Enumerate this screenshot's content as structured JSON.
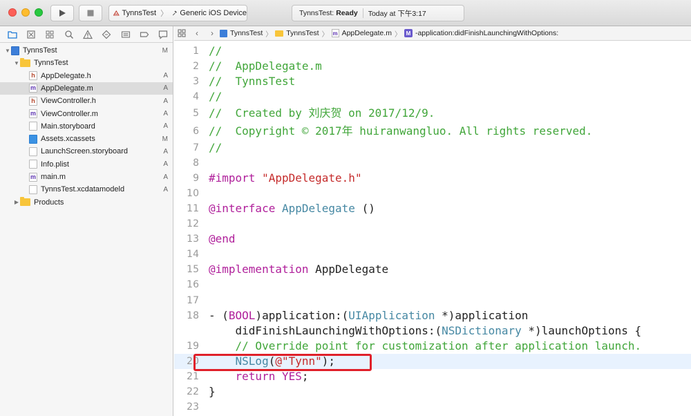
{
  "toolbar": {
    "scheme_project": "TynnsTest",
    "scheme_device": "Generic iOS Device",
    "status_project": "TynnsTest:",
    "status_state": "Ready",
    "status_time": "Today at 下午3:17"
  },
  "navigator": {
    "tabs": [
      "folder-icon",
      "source-control-icon",
      "symbol-icon",
      "search-icon",
      "warning-icon",
      "test-icon",
      "debug-icon",
      "breakpoint-icon",
      "report-icon"
    ],
    "project_status": "M",
    "items": [
      {
        "label": "TynnsTest",
        "kind": "project",
        "indent": 0,
        "disclosure": "▼",
        "status": "M"
      },
      {
        "label": "TynnsTest",
        "kind": "folder",
        "indent": 1,
        "disclosure": "▼",
        "status": ""
      },
      {
        "label": "AppDelegate.h",
        "kind": "h",
        "indent": 2,
        "status": "A"
      },
      {
        "label": "AppDelegate.m",
        "kind": "m",
        "indent": 2,
        "status": "A",
        "selected": true
      },
      {
        "label": "ViewController.h",
        "kind": "h",
        "indent": 2,
        "status": "A"
      },
      {
        "label": "ViewController.m",
        "kind": "m",
        "indent": 2,
        "status": "A"
      },
      {
        "label": "Main.storyboard",
        "kind": "sb",
        "indent": 2,
        "status": "A"
      },
      {
        "label": "Assets.xcassets",
        "kind": "assets",
        "indent": 2,
        "status": "M"
      },
      {
        "label": "LaunchScreen.storyboard",
        "kind": "sb",
        "indent": 2,
        "status": "A"
      },
      {
        "label": "Info.plist",
        "kind": "pl",
        "indent": 2,
        "status": "A"
      },
      {
        "label": "main.m",
        "kind": "m",
        "indent": 2,
        "status": "A"
      },
      {
        "label": "TynnsTest.xcdatamodeld",
        "kind": "dm",
        "indent": 2,
        "status": "A"
      },
      {
        "label": "Products",
        "kind": "folder",
        "indent": 1,
        "disclosure": "▶",
        "status": ""
      }
    ]
  },
  "jumpbar": {
    "crumbs": [
      "TynnsTest",
      "TynnsTest",
      "AppDelegate.m",
      "-application:didFinishLaunchingWithOptions:"
    ]
  },
  "editor": {
    "current_line": "20",
    "lines": [
      {
        "n": "1",
        "tokens": [
          [
            "c-comment",
            "//"
          ]
        ]
      },
      {
        "n": "2",
        "tokens": [
          [
            "c-comment",
            "//  AppDelegate.m"
          ]
        ]
      },
      {
        "n": "3",
        "tokens": [
          [
            "c-comment",
            "//  TynnsTest"
          ]
        ]
      },
      {
        "n": "4",
        "tokens": [
          [
            "c-comment",
            "//"
          ]
        ]
      },
      {
        "n": "5",
        "tokens": [
          [
            "c-comment",
            "//  Created by 刘庆贺 on 2017/12/9."
          ]
        ]
      },
      {
        "n": "6",
        "tokens": [
          [
            "c-comment",
            "//  Copyright © 2017年 huiranwangluo. All rights reserved."
          ]
        ]
      },
      {
        "n": "7",
        "tokens": [
          [
            "c-comment",
            "//"
          ]
        ]
      },
      {
        "n": "8",
        "tokens": []
      },
      {
        "n": "9",
        "tokens": [
          [
            "c-kw",
            "#import"
          ],
          [
            "c-plain",
            " "
          ],
          [
            "c-str",
            "\"AppDelegate.h\""
          ]
        ]
      },
      {
        "n": "10",
        "tokens": []
      },
      {
        "n": "11",
        "tokens": [
          [
            "c-kw",
            "@interface"
          ],
          [
            "c-plain",
            " "
          ],
          [
            "c-type",
            "AppDelegate"
          ],
          [
            "c-plain",
            " ()"
          ]
        ]
      },
      {
        "n": "12",
        "tokens": []
      },
      {
        "n": "13",
        "tokens": [
          [
            "c-kw",
            "@end"
          ]
        ]
      },
      {
        "n": "14",
        "tokens": []
      },
      {
        "n": "15",
        "tokens": [
          [
            "c-kw",
            "@implementation"
          ],
          [
            "c-plain",
            " AppDelegate"
          ]
        ]
      },
      {
        "n": "16",
        "tokens": []
      },
      {
        "n": "17",
        "tokens": []
      },
      {
        "n": "18",
        "tokens": [
          [
            "c-plain",
            "- ("
          ],
          [
            "c-kw",
            "BOOL"
          ],
          [
            "c-plain",
            ")application:("
          ],
          [
            "c-type",
            "UIApplication"
          ],
          [
            "c-plain",
            " *)application"
          ]
        ]
      },
      {
        "n": "",
        "tokens": [
          [
            "c-plain",
            "    didFinishLaunchingWithOptions:("
          ],
          [
            "c-type",
            "NSDictionary"
          ],
          [
            "c-plain",
            " *)launchOptions {"
          ]
        ]
      },
      {
        "n": "19",
        "tokens": [
          [
            "c-comment",
            "    // Override point for customization after application launch."
          ]
        ]
      },
      {
        "n": "20",
        "tokens": [
          [
            "c-plain",
            "    "
          ],
          [
            "c-type",
            "NSLog"
          ],
          [
            "c-plain",
            "("
          ],
          [
            "c-str",
            "@\"Tynn\""
          ],
          [
            "c-plain",
            ");"
          ]
        ]
      },
      {
        "n": "21",
        "tokens": [
          [
            "c-plain",
            "    "
          ],
          [
            "c-kw",
            "return"
          ],
          [
            "c-plain",
            " "
          ],
          [
            "c-kw",
            "YES"
          ],
          [
            "c-plain",
            ";"
          ]
        ]
      },
      {
        "n": "22",
        "tokens": [
          [
            "c-plain",
            "}"
          ]
        ]
      },
      {
        "n": "23",
        "tokens": []
      }
    ]
  },
  "colors": {
    "comment": "#41a63a",
    "string": "#c52b2b",
    "keyword": "#b0209b",
    "type": "#4688a3",
    "highlight_box": "#e0202a",
    "current_line_bg": "#e8f2fe"
  }
}
